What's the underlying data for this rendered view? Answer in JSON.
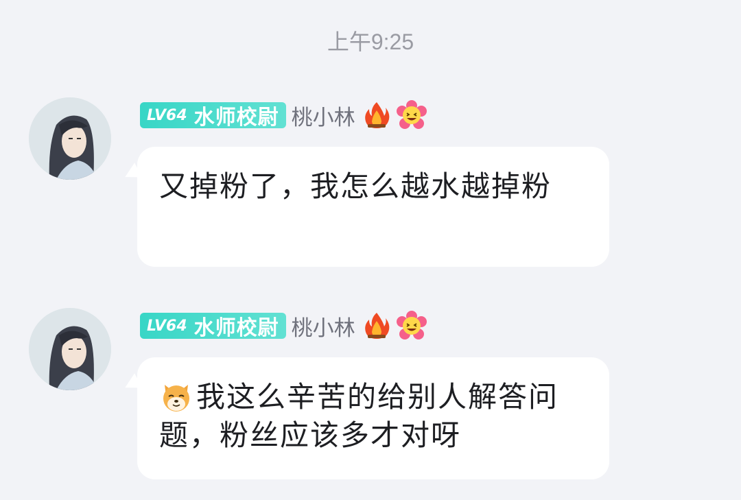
{
  "timestamp": "上午9:25",
  "messages": [
    {
      "level": "LV64",
      "rank": "水师校尉",
      "username": "桃小林",
      "badges": [
        "fire-icon",
        "laughing-flower-icon"
      ],
      "text": "又掉粉了，我怎么越水越掉粉"
    },
    {
      "level": "LV64",
      "rank": "水师校尉",
      "username": "桃小林",
      "badges": [
        "fire-icon",
        "laughing-flower-icon"
      ],
      "emoji": "shiba-dog-icon",
      "text": "我这么辛苦的给别人解答问题，粉丝应该多才对呀"
    }
  ],
  "colors": {
    "background": "#f2f3f7",
    "bubble": "#ffffff",
    "level_badge": "#38d6c6",
    "timestamp": "#9a9ba3",
    "username": "#6f717c"
  }
}
